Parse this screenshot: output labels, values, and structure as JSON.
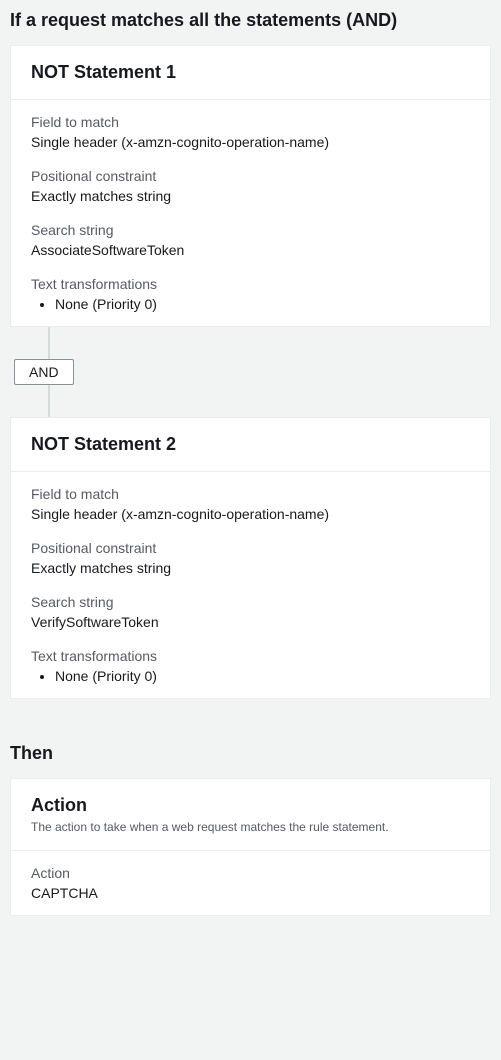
{
  "if_section": {
    "heading": "If a request matches all the statements (AND)",
    "operator": "AND",
    "statements": [
      {
        "title": "NOT Statement 1",
        "field_match_label": "Field to match",
        "field_match_value": "Single header (x-amzn-cognito-operation-name)",
        "positional_label": "Positional constraint",
        "positional_value": "Exactly matches string",
        "search_label": "Search string",
        "search_value": "AssociateSoftwareToken",
        "transform_label": "Text transformations",
        "transform_item": "None (Priority 0)"
      },
      {
        "title": "NOT Statement 2",
        "field_match_label": "Field to match",
        "field_match_value": "Single header (x-amzn-cognito-operation-name)",
        "positional_label": "Positional constraint",
        "positional_value": "Exactly matches string",
        "search_label": "Search string",
        "search_value": "VerifySoftwareToken",
        "transform_label": "Text transformations",
        "transform_item": "None (Priority 0)"
      }
    ]
  },
  "then_section": {
    "heading": "Then",
    "action_card": {
      "title": "Action",
      "subtitle": "The action to take when a web request matches the rule statement.",
      "field_label": "Action",
      "field_value": "CAPTCHA"
    }
  }
}
